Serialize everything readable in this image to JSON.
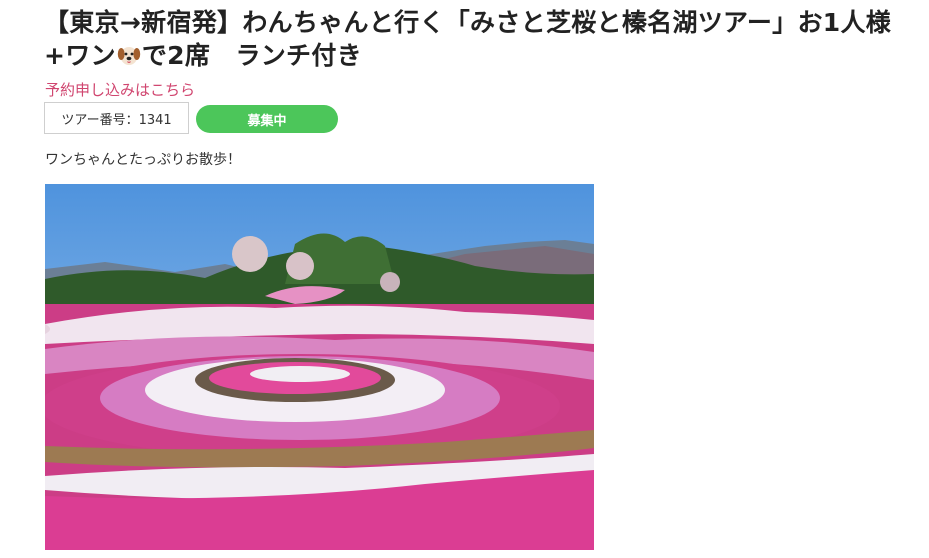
{
  "tour": {
    "title_part1": "【東京→新宿発】わんちゃんと行く「みさと芝桜と榛名湖ツアー」お1人様+ワン",
    "title_part2": "で2席　ランチ付き",
    "title_icon": "dog-face-icon",
    "reserve_link": "予約申し込みはこちら",
    "tour_number": "ツアー番号：1341",
    "status_badge": "募集中",
    "description": "ワンちゃんとたっぷりお散歩！"
  },
  "colors": {
    "link": "#d0456f",
    "badge_green": "#4cc65a",
    "sky": "#5b9ee0",
    "pink_flower": "#e0459a",
    "white_flower": "#f3eef5"
  }
}
